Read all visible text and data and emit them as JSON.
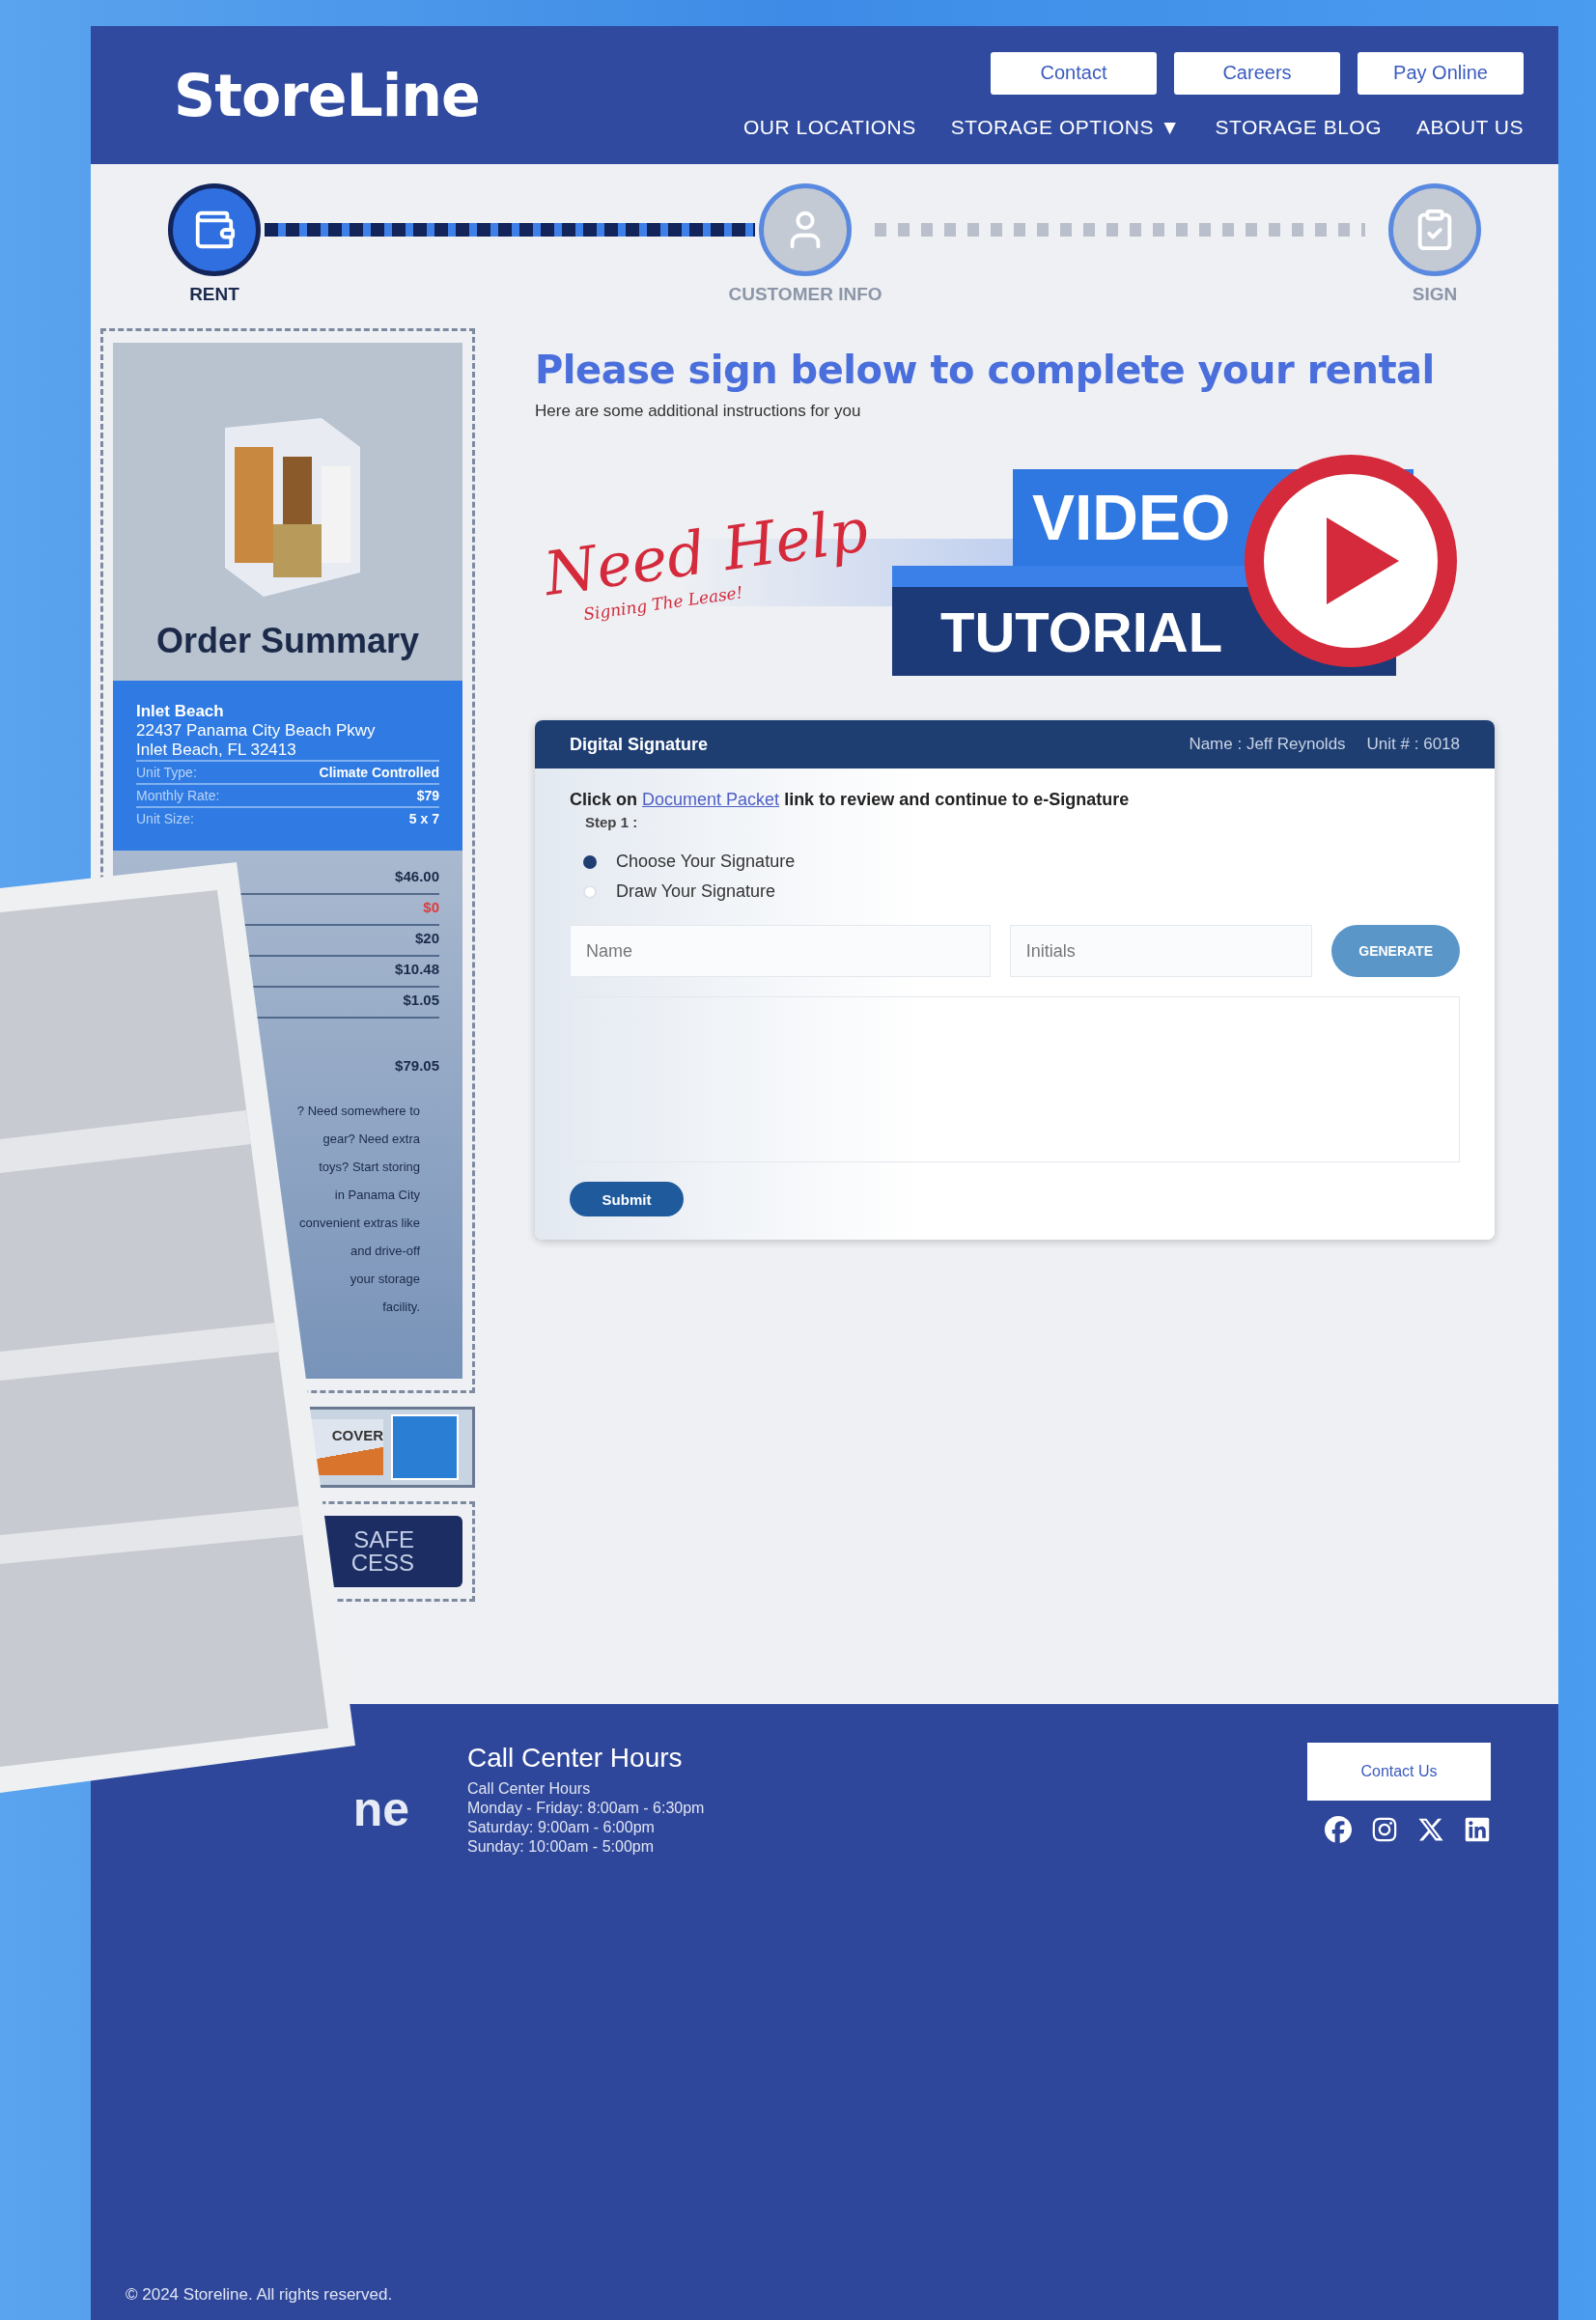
{
  "header": {
    "logo": "StoreLine",
    "top_buttons": [
      "Contact",
      "Careers",
      "Pay Online"
    ],
    "nav": [
      "OUR LOCATIONS",
      "STORAGE OPTIONS ▼",
      "STORAGE BLOG",
      "ABOUT US"
    ]
  },
  "steps": [
    {
      "label": "RENT",
      "selected": true,
      "kind": "wallet"
    },
    {
      "label": "CUSTOMER INFO",
      "selected": false,
      "kind": "person"
    },
    {
      "label": "SIGN",
      "selected": false,
      "kind": "clipboard"
    }
  ],
  "order_summary": {
    "title": "Order Summary",
    "location_name": "Inlet Beach",
    "address_lines": [
      "22437 Panama City Beach Pkwy",
      "Inlet Beach, FL 32413"
    ],
    "unit_details": [
      {
        "label": "Unit Type:",
        "value": "Climate Controlled"
      },
      {
        "label": "Monthly Rate:",
        "value": "$79"
      },
      {
        "label": "Unit Size:",
        "value": "5 x 7"
      }
    ],
    "charges": [
      {
        "value": "$46.00",
        "kind": "normal"
      },
      {
        "value": "$0",
        "kind": "discount"
      },
      {
        "value": "$20",
        "kind": "normal"
      },
      {
        "value": "$10.48",
        "kind": "normal"
      },
      {
        "value": "$1.05",
        "kind": "normal"
      }
    ],
    "total": "$79.05",
    "note_lines": [
      "? Need somewhere to",
      "gear? Need extra",
      "toys? Start storing",
      "in Panama City",
      "convenient extras like",
      "and drive-off",
      "your storage",
      "facility."
    ],
    "card_fragment": "COVER",
    "badge_lines": [
      "SAFE",
      "CESS"
    ]
  },
  "main": {
    "title": "Please sign below to complete your rental",
    "subtitle": "Here are some additional instructions for you",
    "banner": {
      "script": "Need Help",
      "tagline": "Signing The Lease!",
      "word_1": "VIDEO",
      "word_2": "TUTORIAL"
    }
  },
  "signature": {
    "title": "Digital Signature",
    "name": "Name : Jeff Reynolds",
    "unit": "Unit # : 6018",
    "instruction_before": "Click on",
    "link": "Document Packet",
    "instruction_after": "link to review and continue to e-Signature",
    "step": "Step 1 :",
    "options": [
      {
        "label": "Choose Your Signature",
        "selected": true
      },
      {
        "label": "Draw Your Signature",
        "selected": false
      }
    ],
    "name_placeholder": "Name",
    "initials_placeholder": "Initials",
    "generate": "GENERATE",
    "submit": "Submit"
  },
  "footer": {
    "logo_fragment": "ne",
    "hours_title": "Call Center Hours",
    "hours_lines": [
      "Call Center Hours",
      "Monday - Friday: 8:00am - 6:30pm",
      "Saturday: 9:00am - 6:00pm",
      "Sunday: 10:00am - 5:00pm"
    ],
    "contact": "Contact Us",
    "copyright": "© 2024 Storeline. All rights reserved."
  }
}
